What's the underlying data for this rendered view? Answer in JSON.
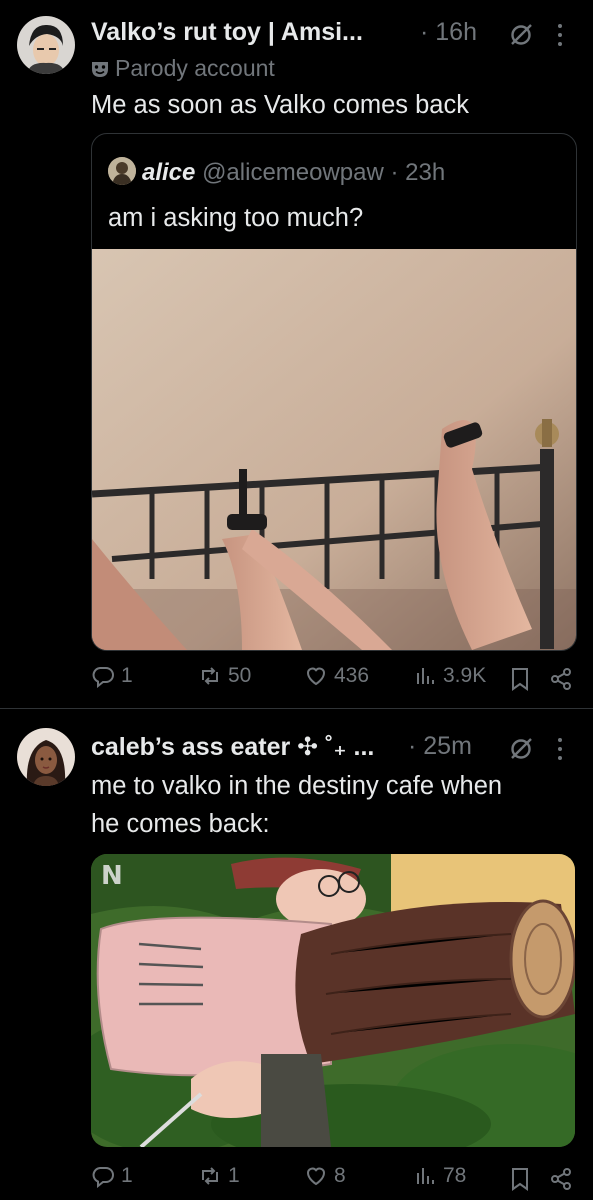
{
  "tweets": [
    {
      "display_name": "Valko’s rut toy | Amsi...",
      "time": "· 16h",
      "badge_label": "Parody account",
      "text": "Me as soon as Valko comes back",
      "quote": {
        "name": "alice",
        "handle_time": "@alicemeowpaw · 23h",
        "text": "am i asking too much?"
      },
      "actions": {
        "replies": "1",
        "reposts": "50",
        "likes": "436",
        "views": "3.9K"
      }
    },
    {
      "display_name": "caleb’s ass eater ✣ ˚₊ ...",
      "time": "· 25m",
      "text_line1": "me to valko in the destiny cafe when",
      "text_line2": "he comes back:",
      "actions": {
        "replies": "1",
        "reposts": "1",
        "likes": "8",
        "views": "78"
      }
    }
  ],
  "icons": [
    "reply-icon",
    "repost-icon",
    "like-icon",
    "views-icon",
    "bookmark-icon",
    "share-icon",
    "grok-icon",
    "more-icon",
    "parody-mask-icon"
  ],
  "colors": {
    "background": "#000000",
    "text": "#e7e9ea",
    "muted": "#71767b",
    "border": "#2f3336"
  }
}
